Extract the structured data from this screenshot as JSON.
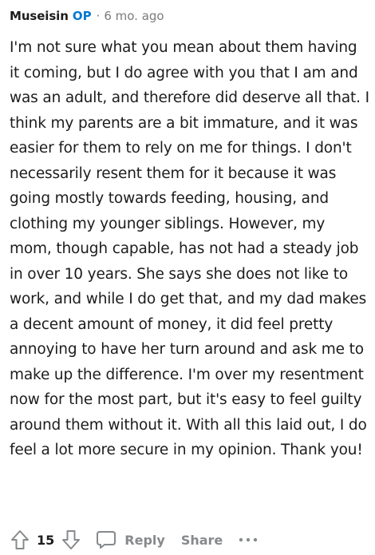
{
  "comment": {
    "author": "Museisin",
    "op_badge": "OP",
    "separator": "·",
    "timestamp": "6 mo. ago",
    "body": "I'm not sure what you mean about them having it coming, but I do agree with you that I am and was an adult, and therefore did deserve all that. I think my parents are a bit immature, and it was easier for them to rely on me for things. I don't necessarily resent them for it because it was going mostly towards feeding, housing, and clothing my younger siblings. However, my mom, though capable, has not had a steady job in over 10 years. She says she does not like to work, and while I do get that, and my dad makes a decent amount of money, it did feel pretty annoying to have her turn around and ask me to make up the difference. I'm over my resentment now for the most part, but it's easy to feel guilty around them without it. With all this laid out, I do feel a lot more secure in my opinion. Thank you!"
  },
  "actions": {
    "score": "15",
    "reply_label": "Reply",
    "share_label": "Share",
    "upvote_icon": "upvote-arrow-icon",
    "downvote_icon": "downvote-arrow-icon",
    "reply_icon": "speech-bubble-icon",
    "more_icon": "ellipsis-icon"
  },
  "colors": {
    "text": "#1c1c1c",
    "muted": "#7c7c7c",
    "op_accent": "#0079d3",
    "action_gray": "#878a8c"
  }
}
